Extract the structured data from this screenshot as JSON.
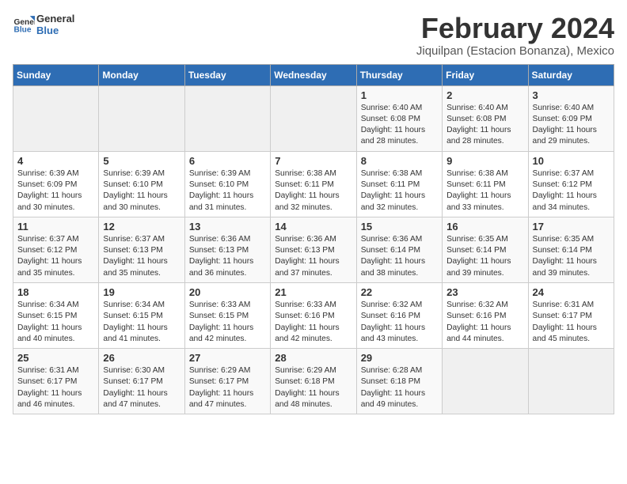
{
  "header": {
    "logo_line1": "General",
    "logo_line2": "Blue",
    "month": "February 2024",
    "location": "Jiquilpan (Estacion Bonanza), Mexico"
  },
  "days_of_week": [
    "Sunday",
    "Monday",
    "Tuesday",
    "Wednesday",
    "Thursday",
    "Friday",
    "Saturday"
  ],
  "weeks": [
    [
      {
        "day": "",
        "info": ""
      },
      {
        "day": "",
        "info": ""
      },
      {
        "day": "",
        "info": ""
      },
      {
        "day": "",
        "info": ""
      },
      {
        "day": "1",
        "info": "Sunrise: 6:40 AM\nSunset: 6:08 PM\nDaylight: 11 hours\nand 28 minutes."
      },
      {
        "day": "2",
        "info": "Sunrise: 6:40 AM\nSunset: 6:08 PM\nDaylight: 11 hours\nand 28 minutes."
      },
      {
        "day": "3",
        "info": "Sunrise: 6:40 AM\nSunset: 6:09 PM\nDaylight: 11 hours\nand 29 minutes."
      }
    ],
    [
      {
        "day": "4",
        "info": "Sunrise: 6:39 AM\nSunset: 6:09 PM\nDaylight: 11 hours\nand 30 minutes."
      },
      {
        "day": "5",
        "info": "Sunrise: 6:39 AM\nSunset: 6:10 PM\nDaylight: 11 hours\nand 30 minutes."
      },
      {
        "day": "6",
        "info": "Sunrise: 6:39 AM\nSunset: 6:10 PM\nDaylight: 11 hours\nand 31 minutes."
      },
      {
        "day": "7",
        "info": "Sunrise: 6:38 AM\nSunset: 6:11 PM\nDaylight: 11 hours\nand 32 minutes."
      },
      {
        "day": "8",
        "info": "Sunrise: 6:38 AM\nSunset: 6:11 PM\nDaylight: 11 hours\nand 32 minutes."
      },
      {
        "day": "9",
        "info": "Sunrise: 6:38 AM\nSunset: 6:11 PM\nDaylight: 11 hours\nand 33 minutes."
      },
      {
        "day": "10",
        "info": "Sunrise: 6:37 AM\nSunset: 6:12 PM\nDaylight: 11 hours\nand 34 minutes."
      }
    ],
    [
      {
        "day": "11",
        "info": "Sunrise: 6:37 AM\nSunset: 6:12 PM\nDaylight: 11 hours\nand 35 minutes."
      },
      {
        "day": "12",
        "info": "Sunrise: 6:37 AM\nSunset: 6:13 PM\nDaylight: 11 hours\nand 35 minutes."
      },
      {
        "day": "13",
        "info": "Sunrise: 6:36 AM\nSunset: 6:13 PM\nDaylight: 11 hours\nand 36 minutes."
      },
      {
        "day": "14",
        "info": "Sunrise: 6:36 AM\nSunset: 6:13 PM\nDaylight: 11 hours\nand 37 minutes."
      },
      {
        "day": "15",
        "info": "Sunrise: 6:36 AM\nSunset: 6:14 PM\nDaylight: 11 hours\nand 38 minutes."
      },
      {
        "day": "16",
        "info": "Sunrise: 6:35 AM\nSunset: 6:14 PM\nDaylight: 11 hours\nand 39 minutes."
      },
      {
        "day": "17",
        "info": "Sunrise: 6:35 AM\nSunset: 6:14 PM\nDaylight: 11 hours\nand 39 minutes."
      }
    ],
    [
      {
        "day": "18",
        "info": "Sunrise: 6:34 AM\nSunset: 6:15 PM\nDaylight: 11 hours\nand 40 minutes."
      },
      {
        "day": "19",
        "info": "Sunrise: 6:34 AM\nSunset: 6:15 PM\nDaylight: 11 hours\nand 41 minutes."
      },
      {
        "day": "20",
        "info": "Sunrise: 6:33 AM\nSunset: 6:15 PM\nDaylight: 11 hours\nand 42 minutes."
      },
      {
        "day": "21",
        "info": "Sunrise: 6:33 AM\nSunset: 6:16 PM\nDaylight: 11 hours\nand 42 minutes."
      },
      {
        "day": "22",
        "info": "Sunrise: 6:32 AM\nSunset: 6:16 PM\nDaylight: 11 hours\nand 43 minutes."
      },
      {
        "day": "23",
        "info": "Sunrise: 6:32 AM\nSunset: 6:16 PM\nDaylight: 11 hours\nand 44 minutes."
      },
      {
        "day": "24",
        "info": "Sunrise: 6:31 AM\nSunset: 6:17 PM\nDaylight: 11 hours\nand 45 minutes."
      }
    ],
    [
      {
        "day": "25",
        "info": "Sunrise: 6:31 AM\nSunset: 6:17 PM\nDaylight: 11 hours\nand 46 minutes."
      },
      {
        "day": "26",
        "info": "Sunrise: 6:30 AM\nSunset: 6:17 PM\nDaylight: 11 hours\nand 47 minutes."
      },
      {
        "day": "27",
        "info": "Sunrise: 6:29 AM\nSunset: 6:17 PM\nDaylight: 11 hours\nand 47 minutes."
      },
      {
        "day": "28",
        "info": "Sunrise: 6:29 AM\nSunset: 6:18 PM\nDaylight: 11 hours\nand 48 minutes."
      },
      {
        "day": "29",
        "info": "Sunrise: 6:28 AM\nSunset: 6:18 PM\nDaylight: 11 hours\nand 49 minutes."
      },
      {
        "day": "",
        "info": ""
      },
      {
        "day": "",
        "info": ""
      }
    ]
  ]
}
